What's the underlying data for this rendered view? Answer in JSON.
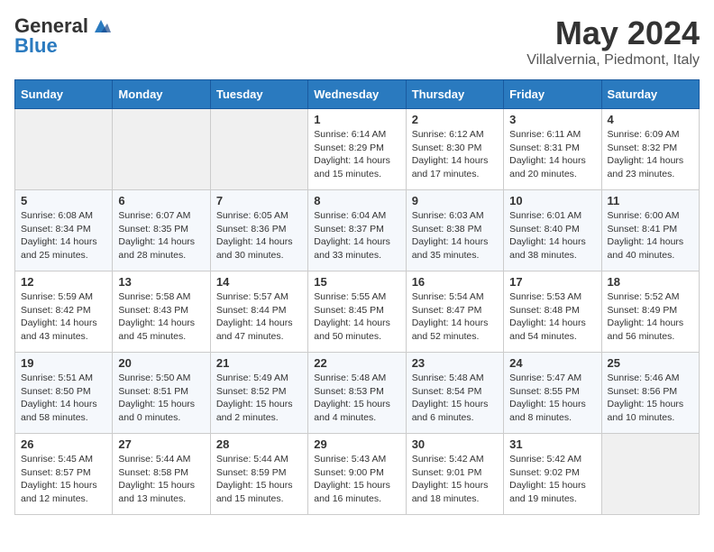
{
  "header": {
    "logo_general": "General",
    "logo_blue": "Blue",
    "title": "May 2024",
    "subtitle": "Villalvernia, Piedmont, Italy"
  },
  "days_of_week": [
    "Sunday",
    "Monday",
    "Tuesday",
    "Wednesday",
    "Thursday",
    "Friday",
    "Saturday"
  ],
  "weeks": [
    [
      {
        "day": "",
        "sunrise": "",
        "sunset": "",
        "daylight": ""
      },
      {
        "day": "",
        "sunrise": "",
        "sunset": "",
        "daylight": ""
      },
      {
        "day": "",
        "sunrise": "",
        "sunset": "",
        "daylight": ""
      },
      {
        "day": "1",
        "sunrise": "Sunrise: 6:14 AM",
        "sunset": "Sunset: 8:29 PM",
        "daylight": "Daylight: 14 hours and 15 minutes."
      },
      {
        "day": "2",
        "sunrise": "Sunrise: 6:12 AM",
        "sunset": "Sunset: 8:30 PM",
        "daylight": "Daylight: 14 hours and 17 minutes."
      },
      {
        "day": "3",
        "sunrise": "Sunrise: 6:11 AM",
        "sunset": "Sunset: 8:31 PM",
        "daylight": "Daylight: 14 hours and 20 minutes."
      },
      {
        "day": "4",
        "sunrise": "Sunrise: 6:09 AM",
        "sunset": "Sunset: 8:32 PM",
        "daylight": "Daylight: 14 hours and 23 minutes."
      }
    ],
    [
      {
        "day": "5",
        "sunrise": "Sunrise: 6:08 AM",
        "sunset": "Sunset: 8:34 PM",
        "daylight": "Daylight: 14 hours and 25 minutes."
      },
      {
        "day": "6",
        "sunrise": "Sunrise: 6:07 AM",
        "sunset": "Sunset: 8:35 PM",
        "daylight": "Daylight: 14 hours and 28 minutes."
      },
      {
        "day": "7",
        "sunrise": "Sunrise: 6:05 AM",
        "sunset": "Sunset: 8:36 PM",
        "daylight": "Daylight: 14 hours and 30 minutes."
      },
      {
        "day": "8",
        "sunrise": "Sunrise: 6:04 AM",
        "sunset": "Sunset: 8:37 PM",
        "daylight": "Daylight: 14 hours and 33 minutes."
      },
      {
        "day": "9",
        "sunrise": "Sunrise: 6:03 AM",
        "sunset": "Sunset: 8:38 PM",
        "daylight": "Daylight: 14 hours and 35 minutes."
      },
      {
        "day": "10",
        "sunrise": "Sunrise: 6:01 AM",
        "sunset": "Sunset: 8:40 PM",
        "daylight": "Daylight: 14 hours and 38 minutes."
      },
      {
        "day": "11",
        "sunrise": "Sunrise: 6:00 AM",
        "sunset": "Sunset: 8:41 PM",
        "daylight": "Daylight: 14 hours and 40 minutes."
      }
    ],
    [
      {
        "day": "12",
        "sunrise": "Sunrise: 5:59 AM",
        "sunset": "Sunset: 8:42 PM",
        "daylight": "Daylight: 14 hours and 43 minutes."
      },
      {
        "day": "13",
        "sunrise": "Sunrise: 5:58 AM",
        "sunset": "Sunset: 8:43 PM",
        "daylight": "Daylight: 14 hours and 45 minutes."
      },
      {
        "day": "14",
        "sunrise": "Sunrise: 5:57 AM",
        "sunset": "Sunset: 8:44 PM",
        "daylight": "Daylight: 14 hours and 47 minutes."
      },
      {
        "day": "15",
        "sunrise": "Sunrise: 5:55 AM",
        "sunset": "Sunset: 8:45 PM",
        "daylight": "Daylight: 14 hours and 50 minutes."
      },
      {
        "day": "16",
        "sunrise": "Sunrise: 5:54 AM",
        "sunset": "Sunset: 8:47 PM",
        "daylight": "Daylight: 14 hours and 52 minutes."
      },
      {
        "day": "17",
        "sunrise": "Sunrise: 5:53 AM",
        "sunset": "Sunset: 8:48 PM",
        "daylight": "Daylight: 14 hours and 54 minutes."
      },
      {
        "day": "18",
        "sunrise": "Sunrise: 5:52 AM",
        "sunset": "Sunset: 8:49 PM",
        "daylight": "Daylight: 14 hours and 56 minutes."
      }
    ],
    [
      {
        "day": "19",
        "sunrise": "Sunrise: 5:51 AM",
        "sunset": "Sunset: 8:50 PM",
        "daylight": "Daylight: 14 hours and 58 minutes."
      },
      {
        "day": "20",
        "sunrise": "Sunrise: 5:50 AM",
        "sunset": "Sunset: 8:51 PM",
        "daylight": "Daylight: 15 hours and 0 minutes."
      },
      {
        "day": "21",
        "sunrise": "Sunrise: 5:49 AM",
        "sunset": "Sunset: 8:52 PM",
        "daylight": "Daylight: 15 hours and 2 minutes."
      },
      {
        "day": "22",
        "sunrise": "Sunrise: 5:48 AM",
        "sunset": "Sunset: 8:53 PM",
        "daylight": "Daylight: 15 hours and 4 minutes."
      },
      {
        "day": "23",
        "sunrise": "Sunrise: 5:48 AM",
        "sunset": "Sunset: 8:54 PM",
        "daylight": "Daylight: 15 hours and 6 minutes."
      },
      {
        "day": "24",
        "sunrise": "Sunrise: 5:47 AM",
        "sunset": "Sunset: 8:55 PM",
        "daylight": "Daylight: 15 hours and 8 minutes."
      },
      {
        "day": "25",
        "sunrise": "Sunrise: 5:46 AM",
        "sunset": "Sunset: 8:56 PM",
        "daylight": "Daylight: 15 hours and 10 minutes."
      }
    ],
    [
      {
        "day": "26",
        "sunrise": "Sunrise: 5:45 AM",
        "sunset": "Sunset: 8:57 PM",
        "daylight": "Daylight: 15 hours and 12 minutes."
      },
      {
        "day": "27",
        "sunrise": "Sunrise: 5:44 AM",
        "sunset": "Sunset: 8:58 PM",
        "daylight": "Daylight: 15 hours and 13 minutes."
      },
      {
        "day": "28",
        "sunrise": "Sunrise: 5:44 AM",
        "sunset": "Sunset: 8:59 PM",
        "daylight": "Daylight: 15 hours and 15 minutes."
      },
      {
        "day": "29",
        "sunrise": "Sunrise: 5:43 AM",
        "sunset": "Sunset: 9:00 PM",
        "daylight": "Daylight: 15 hours and 16 minutes."
      },
      {
        "day": "30",
        "sunrise": "Sunrise: 5:42 AM",
        "sunset": "Sunset: 9:01 PM",
        "daylight": "Daylight: 15 hours and 18 minutes."
      },
      {
        "day": "31",
        "sunrise": "Sunrise: 5:42 AM",
        "sunset": "Sunset: 9:02 PM",
        "daylight": "Daylight: 15 hours and 19 minutes."
      },
      {
        "day": "",
        "sunrise": "",
        "sunset": "",
        "daylight": ""
      }
    ]
  ]
}
